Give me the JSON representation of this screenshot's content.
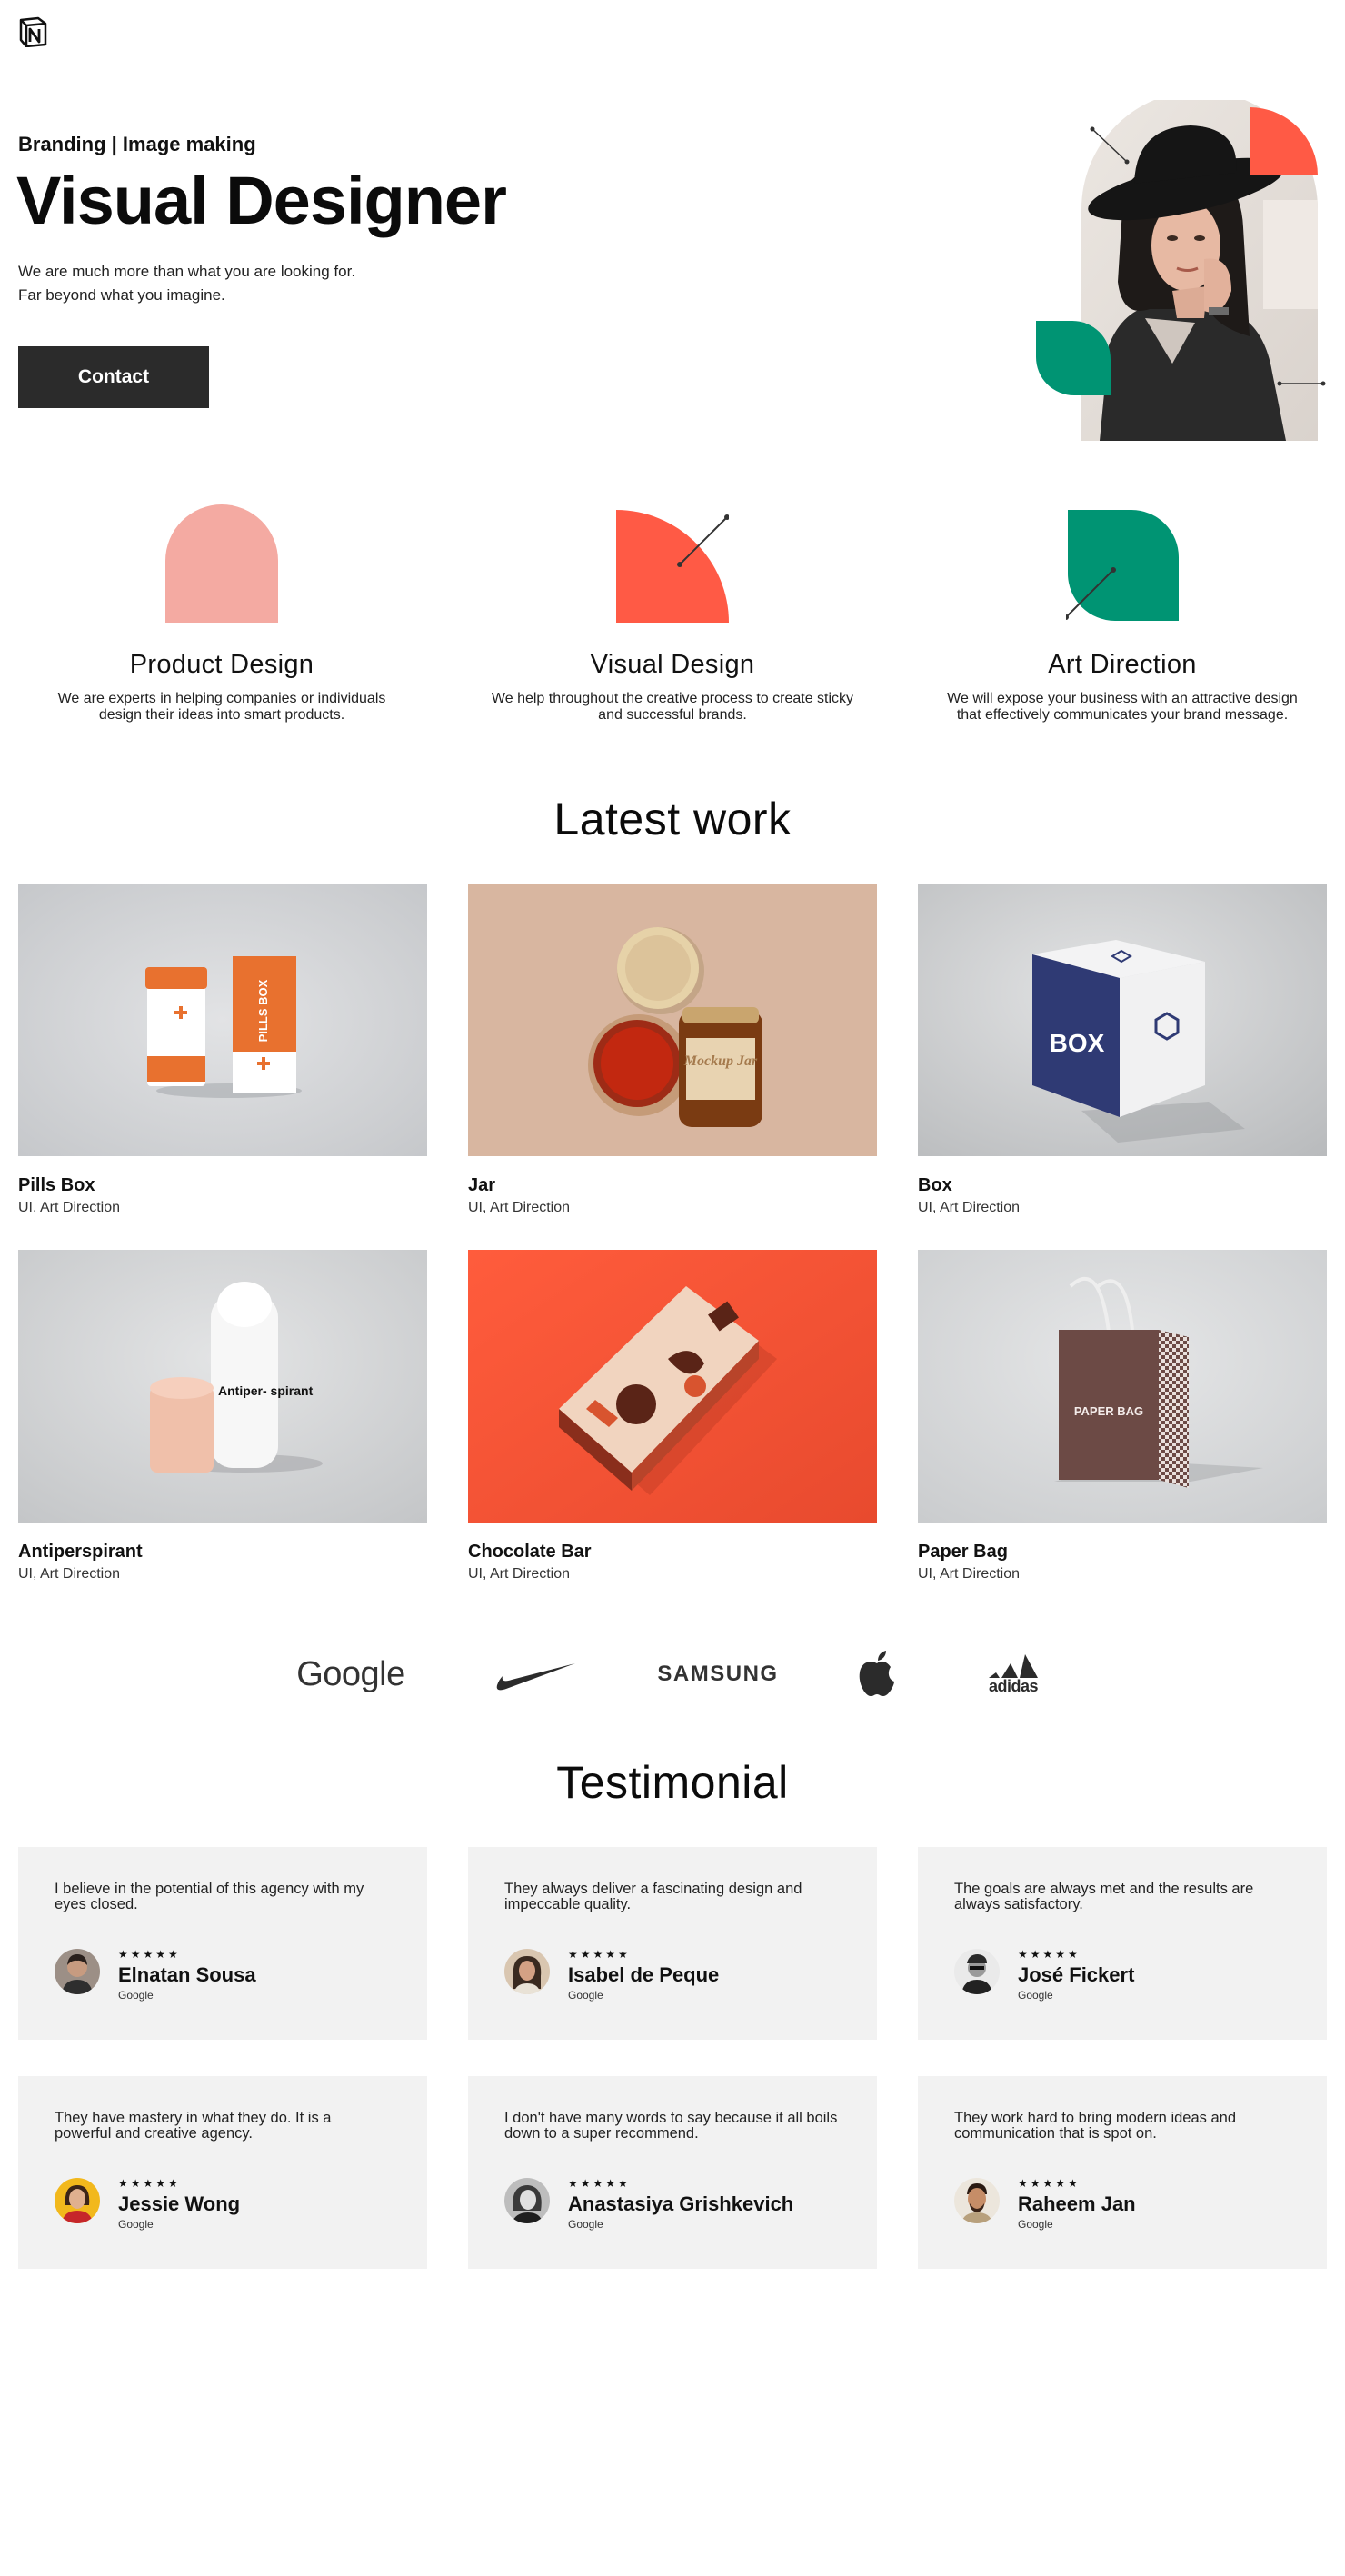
{
  "header": {
    "logo_icon": "notion-logo-icon"
  },
  "hero": {
    "tag": "Branding | Image making",
    "title": "Visual Designer",
    "desc_line1": "We are much more than what you are looking for.",
    "desc_line2": "Far beyond what you imagine.",
    "contact_label": "Contact"
  },
  "colors": {
    "coral": "#ff5a45",
    "pink": "#f4aaa2",
    "green": "#009473",
    "dark": "#2b2b2b"
  },
  "services": [
    {
      "title": "Product Design",
      "desc": "We are experts in helping companies or individuals design their ideas into smart products."
    },
    {
      "title": "Visual Design",
      "desc": "We help throughout the creative process to create sticky and successful brands."
    },
    {
      "title": "Art Direction",
      "desc": "We will expose your business with an attractive design that effectively communicates your brand message."
    }
  ],
  "latest": {
    "title": "Latest work",
    "items": [
      {
        "name": "Pills Box",
        "tags": "UI, Art Direction",
        "label": "PILLS BOX"
      },
      {
        "name": "Jar",
        "tags": "UI, Art Direction",
        "label": "Mockup Jar"
      },
      {
        "name": "Box",
        "tags": "UI, Art Direction",
        "label": "BOX"
      },
      {
        "name": "Antiperspirant",
        "tags": "UI, Art Direction",
        "label": "Antiper- spirant"
      },
      {
        "name": "Chocolate Bar",
        "tags": "UI, Art Direction",
        "label": ""
      },
      {
        "name": "Paper Bag",
        "tags": "UI, Art Direction",
        "label": "PAPER BAG"
      }
    ]
  },
  "brands": {
    "google": "Google",
    "samsung": "SAMSUNG",
    "adidas": "adidas"
  },
  "testimonial": {
    "title": "Testimonial",
    "items": [
      {
        "quote": "I believe in the potential of this agency with my eyes closed.",
        "stars": "★★★★★",
        "name": "Elnatan Sousa",
        "source": "Google"
      },
      {
        "quote": "They always deliver a fascinating design and impeccable quality.",
        "stars": "★★★★★",
        "name": "Isabel de Peque",
        "source": "Google"
      },
      {
        "quote": "The goals are always met and the results are always satisfactory.",
        "stars": "★★★★★",
        "name": "José Fickert",
        "source": "Google"
      },
      {
        "quote": "They have mastery in what they do. It is a powerful and creative agency.",
        "stars": "★★★★★",
        "name": "Jessie Wong",
        "source": "Google"
      },
      {
        "quote": "I don't have many words to say because it all boils down to a super recommend.",
        "stars": "★★★★★",
        "name": "Anastasiya Grishkevich",
        "source": "Google"
      },
      {
        "quote": "They work hard to bring modern ideas and communication that is spot on.",
        "stars": "★★★★★",
        "name": "Raheem Jan",
        "source": "Google"
      }
    ]
  }
}
